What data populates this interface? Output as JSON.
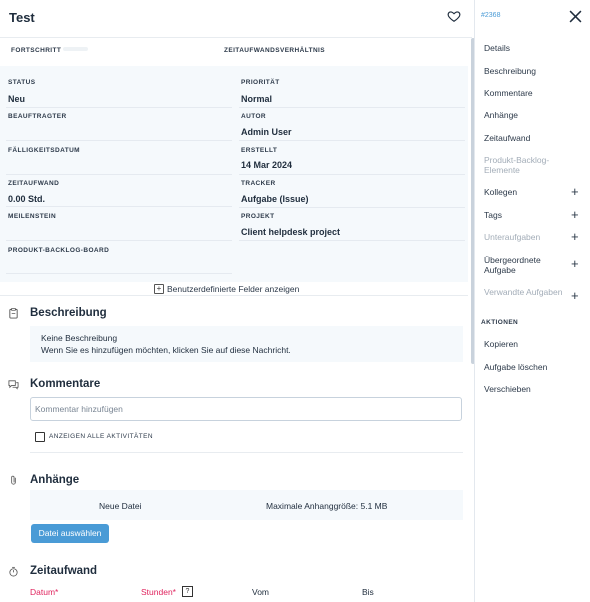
{
  "header": {
    "title": "Test"
  },
  "tabs": {
    "progress": "FORTSCHRITT",
    "time_ratio": "ZEITAUFWANDSVERHÄLTNIS"
  },
  "fields": {
    "status_label": "STATUS",
    "status_value": "Neu",
    "priority_label": "PRIORITÄT",
    "priority_value": "Normal",
    "assignee_label": "BEAUFTRAGTER",
    "assignee_value": "",
    "author_label": "AUTOR",
    "author_value": "Admin User",
    "due_label": "FÄLLIGKEITSDATUM",
    "due_value": "",
    "created_label": "ERSTELLT",
    "created_value": "14 Mar 2024",
    "spent_label": "ZEITAUFWAND",
    "spent_value": "0.00 Std.",
    "tracker_label": "TRACKER",
    "tracker_value": "Aufgabe (Issue)",
    "milestone_label": "MEILENSTEIN",
    "milestone_value": "",
    "project_label": "PROJEKT",
    "project_value": "Client helpdesk project",
    "board_label": "PRODUKT-BACKLOG-BOARD",
    "board_value": ""
  },
  "show_custom_fields": "Benutzerdefinierte Felder anzeigen",
  "description": {
    "title": "Beschreibung",
    "empty_line1": "Keine Beschreibung",
    "empty_line2": "Wenn Sie es hinzufügen möchten, klicken Sie auf diese Nachricht."
  },
  "comments": {
    "title": "Kommentare",
    "placeholder": "Kommentar hinzufügen",
    "show_all_label": "ANZEIGEN ALLE AKTIVITÄTEN",
    "show_all_checked": false
  },
  "attachments": {
    "title": "Anhänge",
    "new_file": "Neue Datei",
    "max_size": "Maximale Anhanggröße: 5.1 MB",
    "choose_button": "Datei auswählen"
  },
  "time": {
    "title": "Zeitaufwand",
    "col_date": "Datum*",
    "col_hours": "Stunden*",
    "col_from": "Vom",
    "col_to": "Bis",
    "help_badge": "?",
    "required_color": "#e0245e"
  },
  "sidebar": {
    "issue_id": "#2368",
    "items": [
      {
        "label": "Details"
      },
      {
        "label": "Beschreibung"
      },
      {
        "label": "Kommentare"
      },
      {
        "label": "Anhänge"
      },
      {
        "label": "Zeitaufwand"
      },
      {
        "label": "Produkt-Backlog-Elemente"
      },
      {
        "label": "Kollegen"
      },
      {
        "label": "Tags"
      },
      {
        "label": "Unteraufgaben"
      },
      {
        "label": "Übergeordnete Aufgabe"
      },
      {
        "label": "Verwandte Aufgaben"
      }
    ],
    "actions_heading": "AKTIONEN",
    "actions": [
      {
        "label": "Kopieren"
      },
      {
        "label": "Aufgabe löschen"
      },
      {
        "label": "Verschieben"
      }
    ]
  },
  "colors": {
    "accent": "#4a9bd6",
    "panel_bg": "#f5f9fc"
  }
}
